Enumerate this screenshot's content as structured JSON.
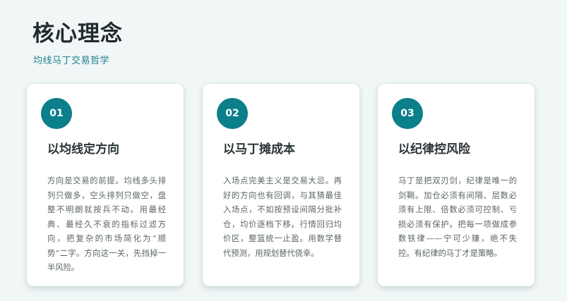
{
  "header": {
    "title": "核心理念",
    "subtitle": "均线马丁交易哲学"
  },
  "colors": {
    "accent": "#0b7f8a",
    "subtitle": "#1f8190",
    "background": "#f1f6f6"
  },
  "cards": [
    {
      "number": "01",
      "title": "以均线定方向",
      "body": "方向是交易的前提。均线多头排列只做多，空头排列只做空，盘整不明朗就按兵不动。用最经典、最经久不衰的指标过滤方向，把复杂的市场简化为“顺势”二字。方向这一关，先挡掉一半风险。"
    },
    {
      "number": "02",
      "title": "以马丁摊成本",
      "body": "入场点完美主义是交易大忌。再好的方向也有回调，与其猜最佳入场点，不如按预设间隔分批补仓，均价逐档下移。行情回归均价区，整篮统一止盈。用数学替代预测，用规划替代侥幸。"
    },
    {
      "number": "03",
      "title": "以纪律控风险",
      "body": "马丁是把双刃剑，纪律是唯一的剑鞘。加仓必须有间隔、层数必须有上限、倍数必须可控制、亏损必须有保护。把每一项做成参数铁律——宁可少赚，绝不失控。有纪律的马丁才是策略。"
    }
  ]
}
